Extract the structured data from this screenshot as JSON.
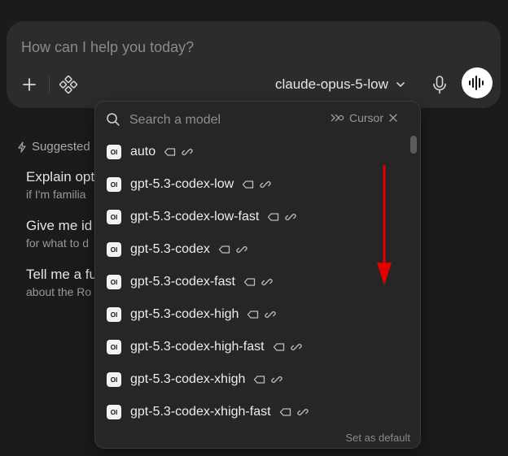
{
  "composer": {
    "placeholder": "How can I help you today?",
    "model": "claude-opus-5-low"
  },
  "suggested": {
    "heading": "Suggested",
    "items": [
      {
        "title": "Explain opt",
        "subtitle": "if I'm familia"
      },
      {
        "title": "Give me id",
        "subtitle": "for what to d"
      },
      {
        "title": "Tell me a fu",
        "subtitle": "about the Ro"
      }
    ]
  },
  "dropdown": {
    "search_placeholder": "Search a model",
    "filter_label": "Cursor",
    "items": [
      {
        "logo": "OI",
        "name": "auto"
      },
      {
        "logo": "OI",
        "name": "gpt-5.3-codex-low"
      },
      {
        "logo": "OI",
        "name": "gpt-5.3-codex-low-fast"
      },
      {
        "logo": "OI",
        "name": "gpt-5.3-codex"
      },
      {
        "logo": "OI",
        "name": "gpt-5.3-codex-fast"
      },
      {
        "logo": "OI",
        "name": "gpt-5.3-codex-high"
      },
      {
        "logo": "OI",
        "name": "gpt-5.3-codex-high-fast"
      },
      {
        "logo": "OI",
        "name": "gpt-5.3-codex-xhigh"
      },
      {
        "logo": "OI",
        "name": "gpt-5.3-codex-xhigh-fast"
      }
    ],
    "footer": "Set as default"
  },
  "colors": {
    "background": "#1b1b1b",
    "composer": "#2c2c2c",
    "dropdown": "#262626",
    "annotation_arrow": "#e50000"
  },
  "icons": [
    "plus-icon",
    "tools-icon",
    "chevron-down-icon",
    "microphone-icon",
    "voice-wave-icon",
    "sparkle-icon",
    "search-icon",
    "cursor-filter-icon",
    "close-icon",
    "tag-icon",
    "link-icon"
  ]
}
